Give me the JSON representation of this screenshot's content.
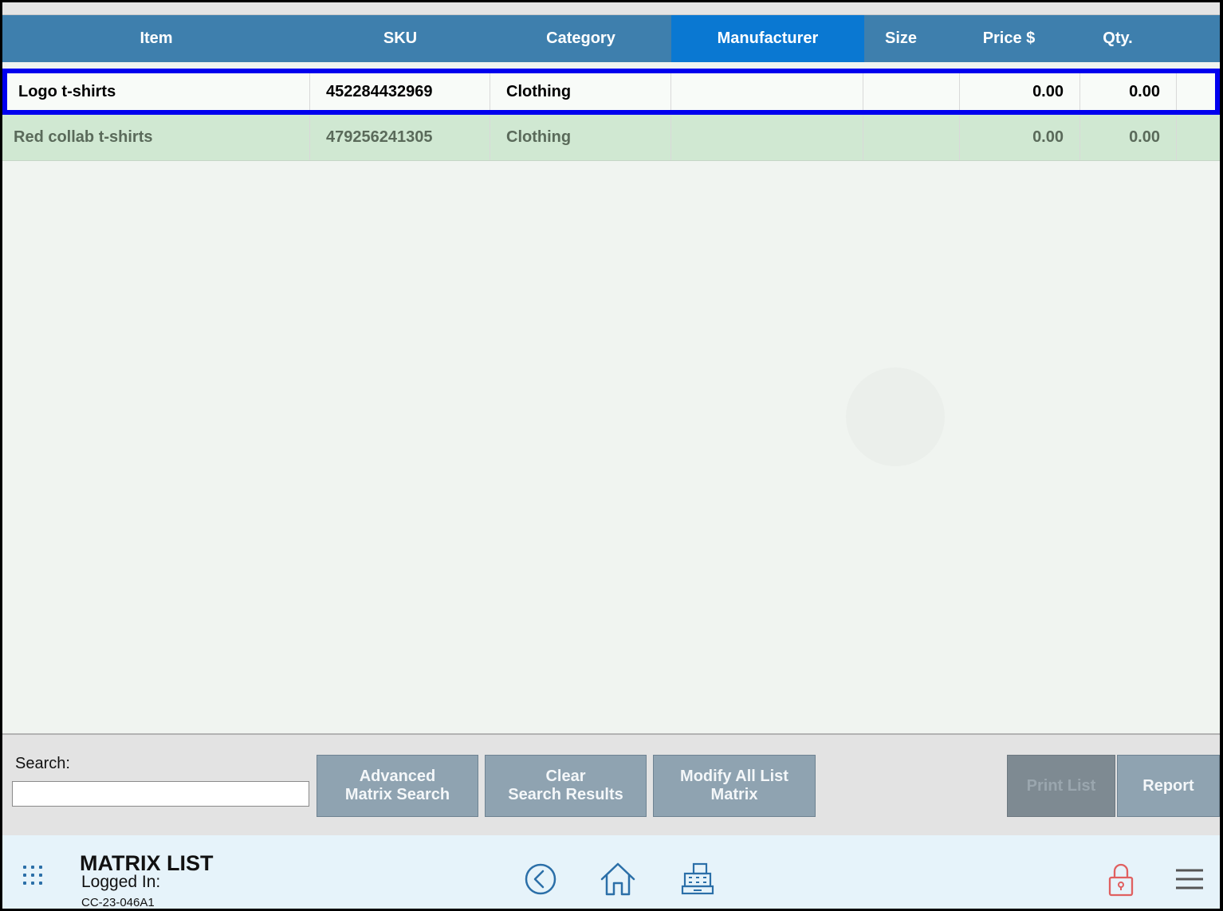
{
  "columns": [
    {
      "label": "Item",
      "active": false
    },
    {
      "label": "SKU",
      "active": false
    },
    {
      "label": "Category",
      "active": false
    },
    {
      "label": "Manufacturer",
      "active": true
    },
    {
      "label": "Size",
      "active": false
    },
    {
      "label": "Price $",
      "active": false
    },
    {
      "label": "Qty.",
      "active": false
    }
  ],
  "rows": [
    {
      "item": "Logo t-shirts",
      "sku": "452284432969",
      "category": "Clothing",
      "manufacturer": "",
      "size": "",
      "price": "0.00",
      "qty": "0.00",
      "selected": true
    },
    {
      "item": "Red collab t-shirts",
      "sku": "479256241305",
      "category": "Clothing",
      "manufacturer": "",
      "size": "",
      "price": "0.00",
      "qty": "0.00",
      "selected": false
    }
  ],
  "toolbar": {
    "search_label": "Search:",
    "search_value": "",
    "advanced_label": "Advanced\nMatrix Search",
    "clear_label": "Clear\nSearch Results",
    "modify_label": "Modify All List\nMatrix",
    "print_label": "Print List",
    "report_label": "Report"
  },
  "footer": {
    "title": "MATRIX LIST",
    "logged_in": "Logged In:",
    "device": "CC-23-046A1"
  },
  "icons": {
    "apps": "grid-icon",
    "back": "back-arrow-icon",
    "home": "home-icon",
    "register": "cash-register-icon",
    "lock": "lock-icon",
    "menu": "hamburger-menu-icon"
  },
  "colors": {
    "header": "#3e7fad",
    "header_active": "#0a78d2",
    "selection_border": "#0000ee",
    "row_alt": "#d0e8d2",
    "icon_blue": "#2b6fa8",
    "lock_red": "#e06060"
  }
}
